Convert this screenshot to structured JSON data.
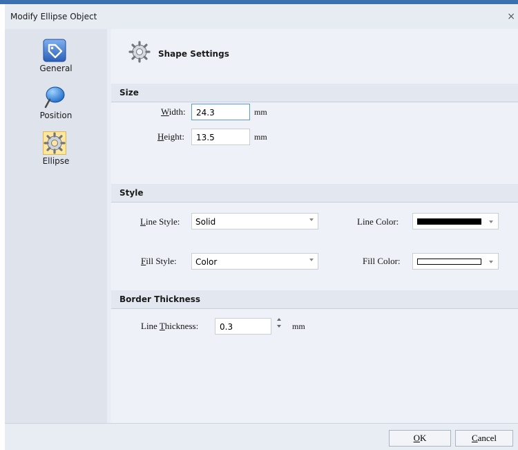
{
  "window": {
    "title": "Modify Ellipse Object",
    "close_glyph": "×"
  },
  "sidebar": {
    "items": [
      {
        "label": "General",
        "icon": "tag-icon",
        "selected": false
      },
      {
        "label": "Position",
        "icon": "pushpin-icon",
        "selected": false
      },
      {
        "label": "Ellipse",
        "icon": "gear-icon",
        "selected": true
      }
    ]
  },
  "page": {
    "title": "Shape Settings",
    "icon": "gear-icon"
  },
  "size": {
    "header": "Size",
    "width": {
      "label_mnemonic": "W",
      "label_rest": "idth:",
      "value": "24.3",
      "unit": "mm"
    },
    "height": {
      "label_mnemonic": "H",
      "label_rest": "eight:",
      "value": "13.5",
      "unit": "mm"
    }
  },
  "style": {
    "header": "Style",
    "line_style": {
      "label_mnemonic": "L",
      "label_rest": "ine Style:",
      "value": "Solid"
    },
    "fill_style": {
      "label_mnemonic": "F",
      "label_rest": "ill Style:",
      "value": "Color"
    },
    "line_color": {
      "label": "Line Color:",
      "color": "#000000"
    },
    "fill_color": {
      "label": "Fill Color:",
      "color": "#ffffff"
    }
  },
  "border": {
    "header": "Border Thickness",
    "line_thickness": {
      "label_prefix": "Line ",
      "label_mnemonic": "T",
      "label_rest": "hickness:",
      "value": "0.3",
      "unit": "mm"
    }
  },
  "buttons": {
    "ok": {
      "mnemonic": "O",
      "rest": "K"
    },
    "cancel": {
      "mnemonic": "C",
      "rest": "ancel"
    }
  }
}
